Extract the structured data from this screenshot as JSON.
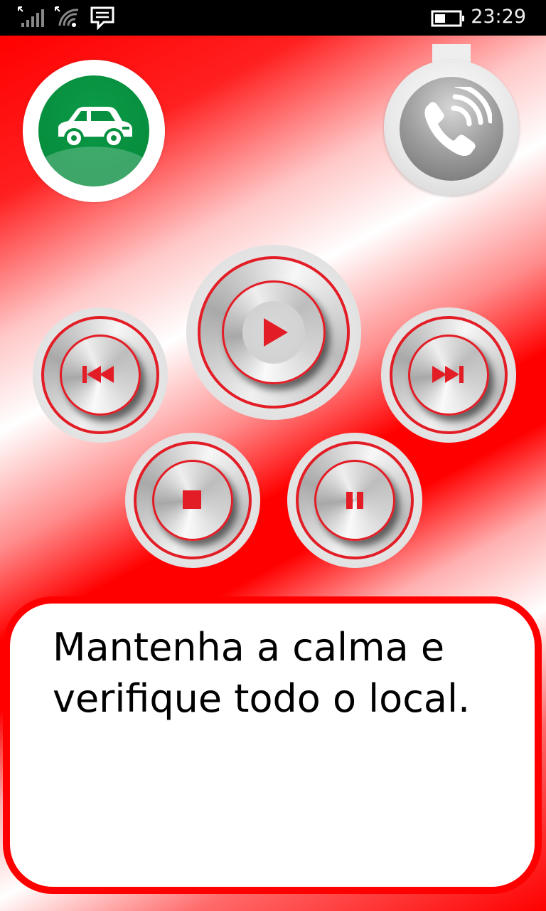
{
  "status_bar": {
    "time": "23:29",
    "icons": [
      "signal-icon",
      "wifi-icon",
      "message-icon",
      "battery-icon"
    ]
  },
  "top_buttons": {
    "car": {
      "icon": "car-icon",
      "color": "#07903f"
    },
    "phone": {
      "icon": "phone-icon"
    }
  },
  "media_controls": [
    "play-icon",
    "rewind-icon",
    "fast-forward-icon",
    "stop-icon",
    "pause-icon"
  ],
  "colors": {
    "accent": "#e31d26",
    "background": "#ff0000"
  },
  "message": {
    "line1": "Mantenha a calma e",
    "line2": "verifique todo o local."
  }
}
